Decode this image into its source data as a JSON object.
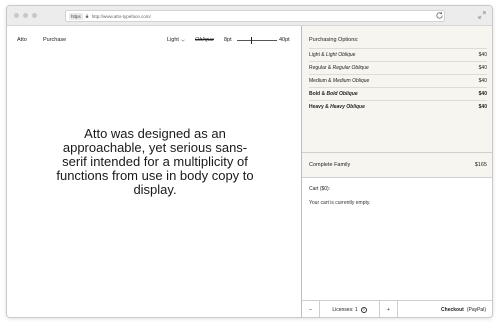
{
  "browser": {
    "protocol": "https",
    "url": "http://www.atto-typeface.com/"
  },
  "nav": {
    "brand": "Atto",
    "purchase": "Purchase"
  },
  "controls": {
    "weight": "Light",
    "oblique": "Oblique",
    "size_min": "8pt",
    "size_max": "40pt",
    "slider_value_fraction": 0.35
  },
  "specimen": "Atto was designed as an approachable, yet serious sans-serif intended for a multiplicity of functions from use in body copy to display.",
  "purchasing": {
    "title": "Purchasing Options:",
    "options": [
      {
        "name": "Light",
        "amp": " & ",
        "oblique": "Light Oblique",
        "price": "$40",
        "bold": false
      },
      {
        "name": "Regular",
        "amp": " & ",
        "oblique": "Regular Oblique",
        "price": "$40",
        "bold": false
      },
      {
        "name": "Medium",
        "amp": " & ",
        "oblique": "Medium Oblique",
        "price": "$40",
        "bold": false
      },
      {
        "name": "Bold",
        "amp": " & ",
        "oblique": "Bold Oblique",
        "price": "$40",
        "bold": true
      },
      {
        "name": "Heavy",
        "amp": " & ",
        "oblique": "Heavy Oblique",
        "price": "$40",
        "bold": true
      }
    ],
    "family_label": "Complete Family",
    "family_price": "$165"
  },
  "cart": {
    "title": "Cart ($0):",
    "empty_message": "Your cart is currently empty."
  },
  "bottom_bar": {
    "minus": "–",
    "licenses": "Licenses: 1",
    "help": "?",
    "plus": "+",
    "checkout": "Checkout",
    "paypal": "(PayPal)"
  }
}
